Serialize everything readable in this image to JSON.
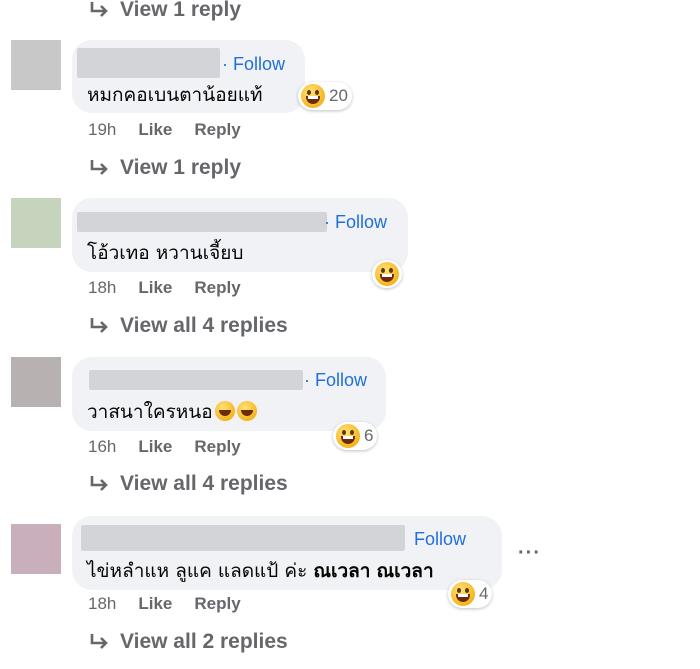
{
  "top_thread": {
    "view_replies": "View 1 reply"
  },
  "comments": [
    {
      "avatar_color": "#c8c8c8",
      "follow": "Follow",
      "text": "หมกคอเบนตาน้อยแท้",
      "reaction": {
        "icon": "grinning-squinting-face-icon",
        "count": "20"
      },
      "time": "19h",
      "like": "Like",
      "reply": "Reply",
      "view_replies": "View 1 reply"
    },
    {
      "avatar_color": "#c6d3bd",
      "follow": "Follow",
      "text": "โอ้วเทอ หวานเจี้ยบ",
      "reaction": {
        "icon": "grinning-squinting-face-icon",
        "count": ""
      },
      "time": "18h",
      "like": "Like",
      "reply": "Reply",
      "view_replies": "View all 4 replies"
    },
    {
      "avatar_color": "#b7b2b1",
      "follow": "Follow",
      "text": "วาสนาใครหนอ",
      "text_emojis": [
        "rolling-on-floor-laughing-icon",
        "rolling-on-floor-laughing-icon"
      ],
      "reaction": {
        "icon": "grinning-squinting-face-icon",
        "count": "6"
      },
      "time": "16h",
      "like": "Like",
      "reply": "Reply",
      "view_replies": "View all 4 replies"
    },
    {
      "avatar_color": "#c9aebb",
      "follow": "Follow",
      "text_plain": "ไข่หลำแห ลูแค แลดแป้ ค่ะ ",
      "text_tag1": "ณเวลา",
      "text_tag2": "ณเวลา",
      "reaction": {
        "icon": "grinning-squinting-face-icon",
        "count": "4"
      },
      "time": "18h",
      "like": "Like",
      "reply": "Reply",
      "more": "···",
      "view_replies": "View all 2 replies"
    }
  ]
}
